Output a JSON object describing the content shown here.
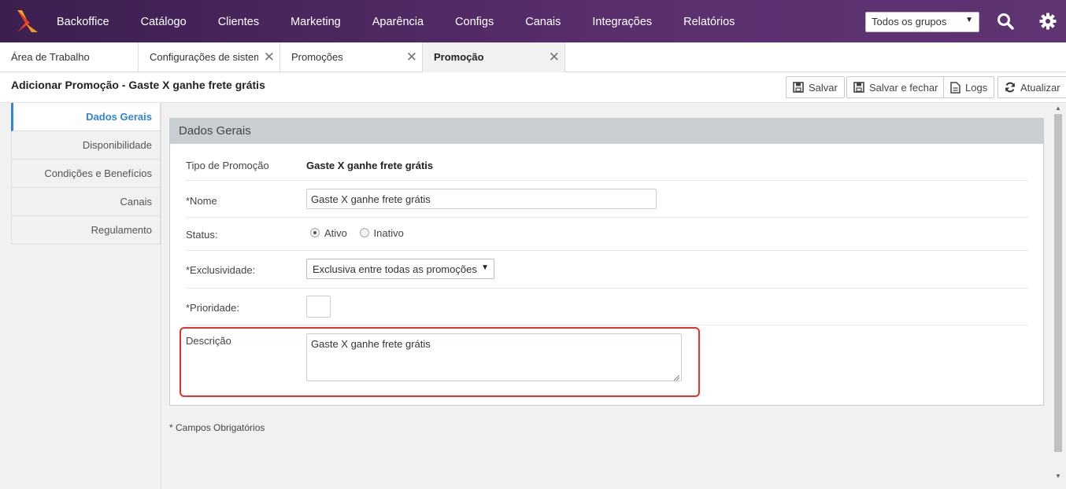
{
  "nav": {
    "items": [
      "Backoffice",
      "Catálogo",
      "Clientes",
      "Marketing",
      "Aparência",
      "Configs",
      "Canais",
      "Integrações",
      "Relatórios"
    ],
    "group_select": "Todos os grupos"
  },
  "tabs": [
    {
      "label": "Área de Trabalho"
    },
    {
      "label": "Configurações de sistema"
    },
    {
      "label": "Promoções"
    },
    {
      "label": "Promoção"
    }
  ],
  "page": {
    "title": "Adicionar Promoção - Gaste X ganhe frete grátis",
    "buttons": {
      "save": "Salvar",
      "save_close": "Salvar e fechar",
      "logs": "Logs",
      "refresh": "Atualizar"
    }
  },
  "sidebar": {
    "items": [
      "Dados Gerais",
      "Disponibilidade",
      "Condições e Benefícios",
      "Canais",
      "Regulamento"
    ]
  },
  "form": {
    "heading": "Dados Gerais",
    "tipo_label": "Tipo de Promoção",
    "tipo_value": "Gaste X ganhe frete grátis",
    "nome_label": "*Nome",
    "nome_value": "Gaste X ganhe frete grátis",
    "status_label": "Status:",
    "status_ativo": "Ativo",
    "status_inativo": "Inativo",
    "exclusividade_label": "*Exclusividade:",
    "exclusividade_value": "Exclusiva entre todas as promoções",
    "prioridade_label": "*Prioridade:",
    "prioridade_value": "",
    "descricao_label": "Descrição",
    "descricao_value": "Gaste X ganhe frete grátis"
  },
  "footer_note": "* Campos Obrigatórios",
  "colors": {
    "topbar": "#4e2a63",
    "accent": "#2f86d8",
    "highlight": "#e8302c"
  }
}
